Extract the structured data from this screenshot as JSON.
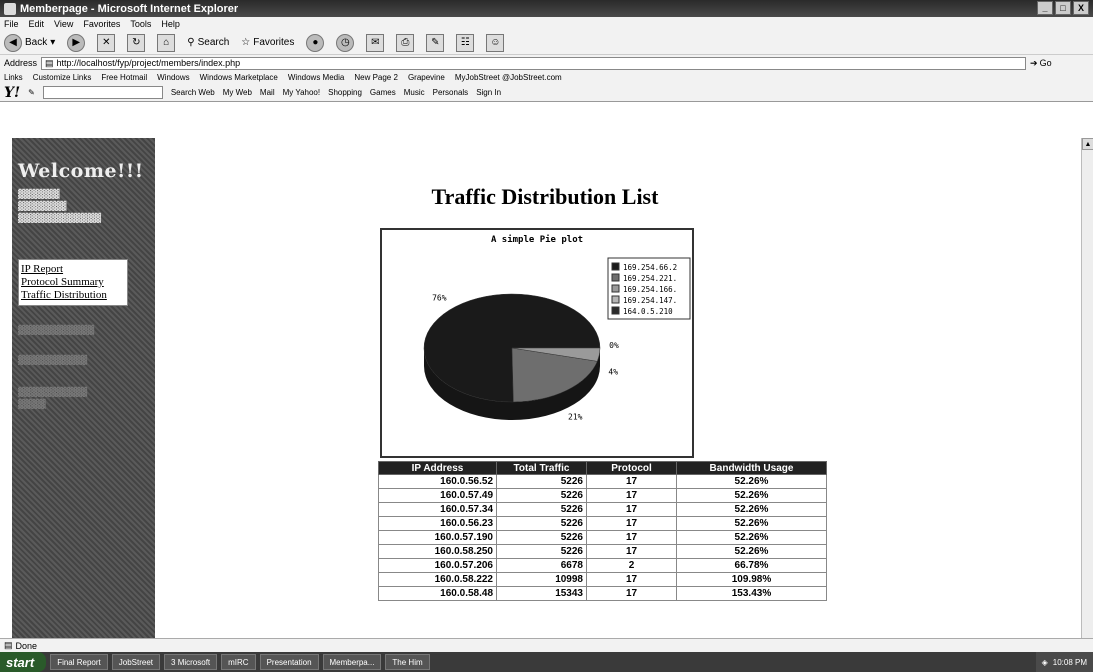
{
  "window": {
    "title": "Memberpage - Microsoft Internet Explorer",
    "buttons": [
      "_",
      "□",
      "X"
    ]
  },
  "menu": [
    "File",
    "Edit",
    "View",
    "Favorites",
    "Tools",
    "Help"
  ],
  "toolbar": {
    "back": "Back",
    "search": "Search",
    "favorites": "Favorites"
  },
  "address": {
    "label": "Address",
    "url": "http://localhost/fyp/project/members/index.php",
    "go": "Go"
  },
  "links": {
    "label": "Links",
    "items": [
      "Customize Links",
      "Free Hotmail",
      "Windows",
      "Windows Marketplace",
      "Windows Media",
      "New Page 2",
      "Grapevine",
      "MyJobStreet @JobStreet.com"
    ]
  },
  "yahoo": {
    "logo": "Y!",
    "search_web": "Search Web",
    "items": [
      "My Web",
      "Mail",
      "My Yahoo!",
      "Shopping",
      "Games",
      "Music",
      "Personals",
      "Sign In"
    ]
  },
  "sidebar": {
    "welcome": "Welcome!!!",
    "nav": [
      "IP Report",
      "Protocol Summary",
      "Traffic Distribution"
    ]
  },
  "page": {
    "title": "Traffic Distribution List"
  },
  "chart_data": {
    "type": "pie",
    "title": "A simple Pie plot",
    "categories": [
      "169.254.66.2",
      "169.254.221.",
      "169.254.166.",
      "169.254.147.",
      "164.0.5.210"
    ],
    "values": [
      76,
      21,
      4,
      0,
      0
    ],
    "slice_labels": [
      "76%",
      "21%",
      "4%",
      "0%",
      ""
    ],
    "colors": [
      "#1a1a1a",
      "#6e6e6e",
      "#9a9a9a",
      "#b5b5b5",
      "#2b2b2b"
    ],
    "legend": "top-right"
  },
  "table": {
    "headers": [
      "IP Address",
      "Total Traffic",
      "Protocol",
      "Bandwidth Usage"
    ],
    "rows": [
      [
        "160.0.56.52",
        "5226",
        "17",
        "52.26%"
      ],
      [
        "160.0.57.49",
        "5226",
        "17",
        "52.26%"
      ],
      [
        "160.0.57.34",
        "5226",
        "17",
        "52.26%"
      ],
      [
        "160.0.56.23",
        "5226",
        "17",
        "52.26%"
      ],
      [
        "160.0.57.190",
        "5226",
        "17",
        "52.26%"
      ],
      [
        "160.0.58.250",
        "5226",
        "17",
        "52.26%"
      ],
      [
        "160.0.57.206",
        "6678",
        "2",
        "66.78%"
      ],
      [
        "160.0.58.222",
        "10998",
        "17",
        "109.98%"
      ],
      [
        "160.0.58.48",
        "15343",
        "17",
        "153.43%"
      ]
    ]
  },
  "status": {
    "text": "Done"
  },
  "taskbar": {
    "start": "start",
    "tasks": [
      "Final Report",
      "JobStreet",
      "3 Microsoft",
      "mIRC",
      "Presentation",
      "Memberpa...",
      "The Him"
    ],
    "clock": "10:08 PM"
  }
}
